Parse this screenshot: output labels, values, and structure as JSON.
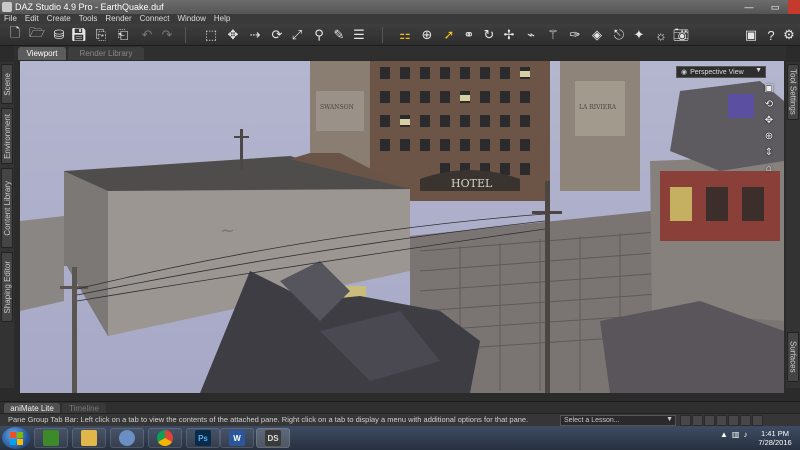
{
  "window": {
    "title": "DAZ Studio 4.9 Pro - EarthQuake.duf",
    "controls": {
      "minimize": "—",
      "maximize": "▭",
      "close": "✕"
    }
  },
  "menu": [
    "File",
    "Edit",
    "Create",
    "Tools",
    "Render",
    "Connect",
    "Window",
    "Help"
  ],
  "toolbar": {
    "file_icons": [
      "new-file-icon",
      "open-folder-icon",
      "merge-folder-icon",
      "save-icon",
      "import-icon",
      "export-icon",
      "undo-icon",
      "redo-icon"
    ],
    "scene_icons": [
      "node-selection-icon",
      "universal-tool-icon",
      "translate-tool-icon",
      "rotate-tool-icon",
      "scale-tool-icon",
      "joint-editor-icon",
      "node-weight-icon",
      "align-icon"
    ],
    "view_icons": [
      "tool-settings-icon",
      "pose-icon",
      "pointer-icon",
      "active-pose-icon",
      "rotate-view-icon",
      "translate-view-icon",
      "geometry-editor-icon",
      "figure-setup-icon",
      "surface-selection-icon",
      "spot-render-icon",
      "camera-icon",
      "light-icon",
      "render-icon"
    ],
    "right_icons": [
      "daz-store-icon",
      "help-icon",
      "settings-icon"
    ]
  },
  "viewport_tabs": [
    "Viewport",
    "Render Library"
  ],
  "left_tabs": [
    "Scene",
    "Environment",
    "Content Library",
    "Shaping Editor"
  ],
  "right_tabs": [
    "Tool Settings",
    "Surfaces"
  ],
  "viewport": {
    "view": "Perspective View",
    "building_signs": [
      "HOTEL",
      "SWANSON",
      "LA RIVIERA"
    ]
  },
  "pane_tabs": [
    "aniMate Lite",
    "Timeline"
  ],
  "status": {
    "text": "Pane Group Tab Bar: Left click on a tab to view the contents of the attached pane. Right click on a tab to display a menu with additional options for that pane.",
    "lesson": "Select a Lesson..."
  },
  "taskbar": {
    "apps": [
      "Green Screen",
      "File Explorer",
      "Media Player",
      "Google Chrome",
      "Photoshop",
      "Microsoft Word",
      "DAZ Studio"
    ],
    "app_labels": [
      "",
      "",
      "",
      "",
      "Ps",
      "W",
      "DS"
    ],
    "time": "1:41 PM",
    "date": "7/28/2016"
  }
}
